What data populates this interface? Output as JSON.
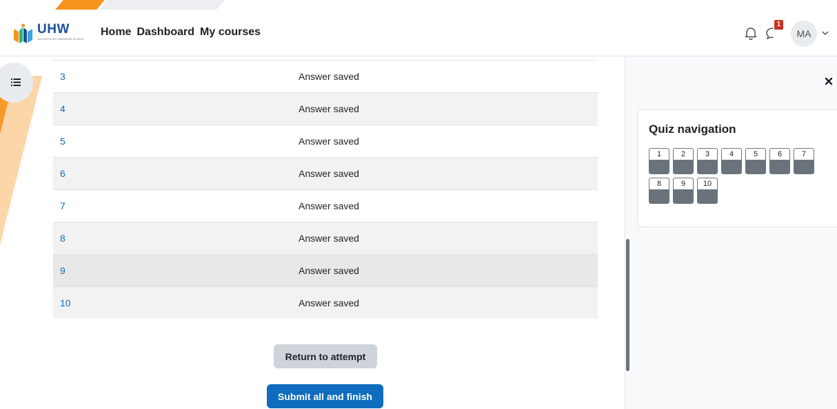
{
  "brand": {
    "name": "UHW",
    "tagline": "UNIVERSITAS HARAPAN WIJAYA"
  },
  "nav": {
    "links": [
      "Home",
      "Dashboard",
      "My courses"
    ]
  },
  "header": {
    "message_badge": "1",
    "avatar_initials": "MA"
  },
  "summary": {
    "rows": [
      {
        "question": "3",
        "status": "Answer saved"
      },
      {
        "question": "4",
        "status": "Answer saved"
      },
      {
        "question": "5",
        "status": "Answer saved"
      },
      {
        "question": "6",
        "status": "Answer saved"
      },
      {
        "question": "7",
        "status": "Answer saved"
      },
      {
        "question": "8",
        "status": "Answer saved"
      },
      {
        "question": "9",
        "status": "Answer saved"
      },
      {
        "question": "10",
        "status": "Answer saved"
      }
    ]
  },
  "actions": {
    "return_label": "Return to attempt",
    "submit_label": "Submit all and finish"
  },
  "quiz_nav": {
    "title": "Quiz navigation",
    "questions": [
      "1",
      "2",
      "3",
      "4",
      "5",
      "6",
      "7",
      "8",
      "9",
      "10"
    ],
    "answered_color": "#6a737b"
  },
  "colors": {
    "accent": "#0f6cbf",
    "brand_orange": "#f7941d",
    "badge": "#ca3120"
  }
}
